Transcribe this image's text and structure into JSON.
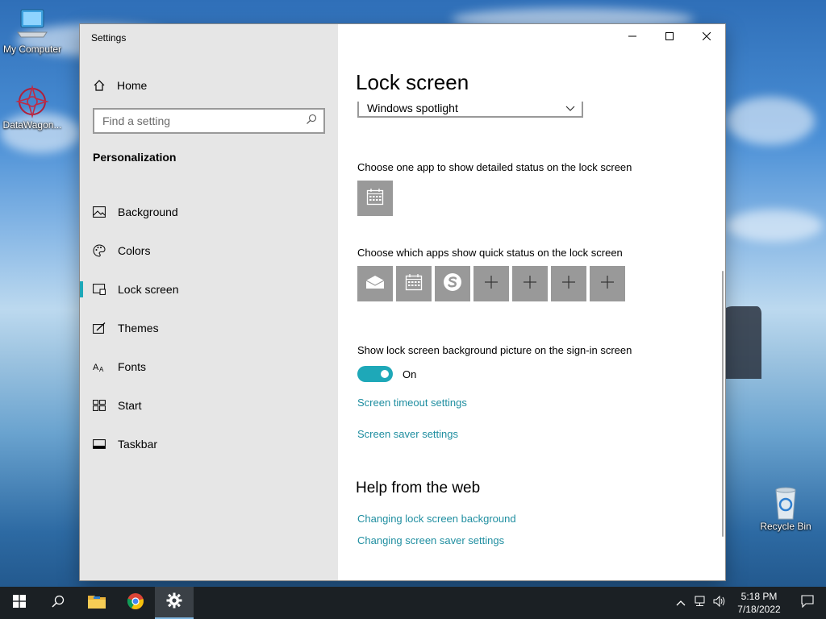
{
  "desktop": {
    "icons": [
      {
        "label": "My Computer"
      },
      {
        "label": "DataWagon..."
      },
      {
        "label": "Recycle Bin"
      }
    ]
  },
  "window": {
    "title": "Settings",
    "controls": {
      "minimize": "minimize-icon",
      "maximize": "maximize-icon",
      "close": "close-icon"
    }
  },
  "sidebar": {
    "home_label": "Home",
    "search_placeholder": "Find a setting",
    "section": "Personalization",
    "items": [
      {
        "label": "Background",
        "icon": "picture-icon"
      },
      {
        "label": "Colors",
        "icon": "palette-icon"
      },
      {
        "label": "Lock screen",
        "icon": "lock-screen-icon",
        "active": true
      },
      {
        "label": "Themes",
        "icon": "brush-icon"
      },
      {
        "label": "Fonts",
        "icon": "fonts-icon"
      },
      {
        "label": "Start",
        "icon": "start-icon"
      },
      {
        "label": "Taskbar",
        "icon": "taskbar-icon"
      }
    ]
  },
  "main": {
    "title": "Lock screen",
    "background_dropdown": {
      "value": "Windows spotlight"
    },
    "detailed_status_label": "Choose one app to show detailed status on the lock screen",
    "quick_status_label": "Choose which apps show quick status on the lock screen",
    "signin_label": "Show lock screen background picture on the sign-in screen",
    "toggle": {
      "state": "On",
      "on": true
    },
    "links": {
      "timeout": "Screen timeout settings",
      "saver": "Screen saver settings"
    },
    "help": {
      "heading": "Help from the web",
      "links": [
        "Changing lock screen background",
        "Changing screen saver settings"
      ]
    }
  },
  "taskbar": {
    "clock_time": "5:18 PM",
    "clock_date": "7/18/2022"
  },
  "colors": {
    "accent": "#1ea8b8",
    "link": "#1f8ea0",
    "tile": "#999999",
    "sidebar_bg": "#e6e6e6",
    "taskbar_bg": "#1b2024"
  }
}
